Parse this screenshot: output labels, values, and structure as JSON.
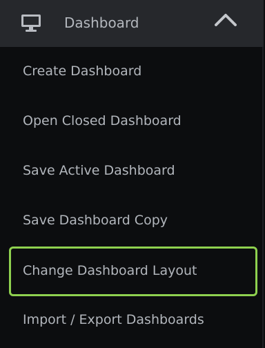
{
  "header": {
    "title": "Dashboard",
    "icon": "monitor-icon",
    "toggle_icon": "chevron-up-icon"
  },
  "menu": {
    "items": [
      {
        "label": "Create Dashboard"
      },
      {
        "label": "Open Closed Dashboard"
      },
      {
        "label": "Save Active Dashboard"
      },
      {
        "label": "Save Dashboard Copy"
      },
      {
        "label": "Change Dashboard Layout",
        "highlighted": true
      },
      {
        "label": "Import / Export Dashboards"
      }
    ]
  },
  "colors": {
    "header_bg": "#26282c",
    "menu_bg": "#0c0d0f",
    "text": "#b2b6bc",
    "highlight_border": "#8fd14f"
  }
}
